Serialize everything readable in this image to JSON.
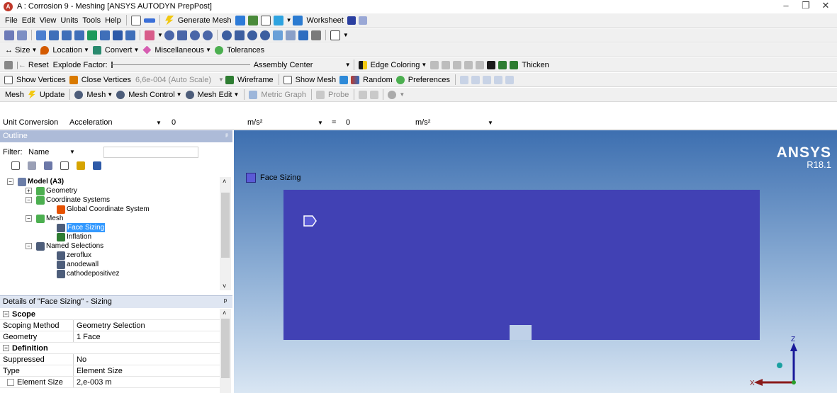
{
  "window": {
    "title": "A : Corrosion 9 - Meshing [ANSYS AUTODYN PrepPost]",
    "minimize": "–",
    "maximize": "❐",
    "close": "✕"
  },
  "menubar": {
    "items": [
      "File",
      "Edit",
      "View",
      "Units",
      "Tools",
      "Help"
    ],
    "generate_mesh": "Generate Mesh",
    "worksheet": "Worksheet"
  },
  "toolbar_select": {
    "prefix": "ᵠ"
  },
  "toolbar_graphics": {
    "size": "Size",
    "location": "Location",
    "convert": "Convert",
    "misc": "Miscellaneous",
    "tolerances": "Tolerances"
  },
  "toolbar_explode": {
    "reset": "Reset",
    "factor_label": "Explode Factor:",
    "assembly": "Assembly Center",
    "edge_coloring": "Edge Coloring",
    "thicken": "Thicken"
  },
  "toolbar_vertices": {
    "show_vertices": "Show Vertices",
    "close_vertices": "Close Vertices",
    "scale": "6,6e-004 (Auto Scale)",
    "wireframe": "Wireframe",
    "show_mesh": "Show Mesh",
    "random": "Random",
    "preferences": "Preferences"
  },
  "toolbar_mesh": {
    "mesh": "Mesh",
    "update": "Update",
    "mesh_menu": "Mesh",
    "mesh_control": "Mesh Control",
    "mesh_edit": "Mesh Edit",
    "metric_graph": "Metric Graph",
    "probe": "Probe"
  },
  "unit_conversion": {
    "label": "Unit Conversion",
    "quantity": "Acceleration",
    "value1": "0",
    "unit1": "m/s²",
    "equals": "=",
    "value2": "0",
    "unit2": "m/s²"
  },
  "outline": {
    "header": "Outline",
    "filter_label": "Filter:",
    "filter_value": "Name",
    "tree": [
      {
        "label": "Model (A3)",
        "bold": true
      },
      {
        "label": "Geometry"
      },
      {
        "label": "Coordinate Systems"
      },
      {
        "label": "Global Coordinate System"
      },
      {
        "label": "Mesh"
      },
      {
        "label": "Face Sizing",
        "selected": true
      },
      {
        "label": "Inflation"
      },
      {
        "label": "Named Selections"
      },
      {
        "label": "zeroflux"
      },
      {
        "label": "anodewall"
      },
      {
        "label": "cathodepositivez"
      }
    ]
  },
  "details": {
    "header": "Details of \"Face Sizing\" - Sizing",
    "pin": "ᵖ",
    "sections": [
      {
        "title": "Scope",
        "rows": [
          {
            "key": "Scoping Method",
            "value": "Geometry Selection"
          },
          {
            "key": "Geometry",
            "value": "1 Face"
          }
        ]
      },
      {
        "title": "Definition",
        "rows": [
          {
            "key": "Suppressed",
            "value": "No"
          },
          {
            "key": "Type",
            "value": "Element Size"
          },
          {
            "key": "Element Size",
            "value": "2,e-003 m"
          }
        ]
      }
    ]
  },
  "viewport": {
    "legend": "Face Sizing",
    "logo_line1": "ANSYS",
    "logo_line2": "R18.1",
    "axis_z": "Z",
    "axis_x": "X",
    "face_color": "#4141b4",
    "legend_color": "#5b5bd6"
  }
}
